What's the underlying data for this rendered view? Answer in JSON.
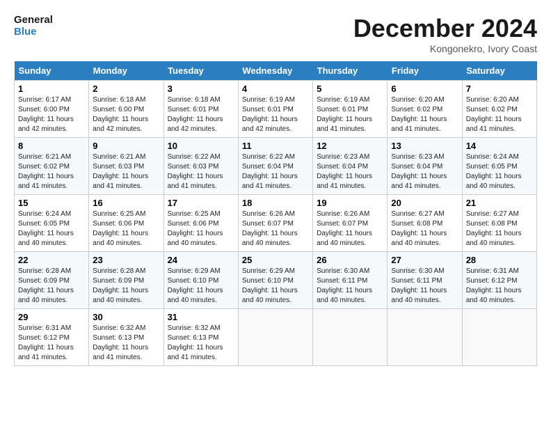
{
  "logo": {
    "line1": "General",
    "line2": "Blue"
  },
  "title": "December 2024",
  "location": "Kongonekro, Ivory Coast",
  "columns": [
    "Sunday",
    "Monday",
    "Tuesday",
    "Wednesday",
    "Thursday",
    "Friday",
    "Saturday"
  ],
  "weeks": [
    [
      {
        "day": "1",
        "rise": "6:17 AM",
        "set": "6:00 PM",
        "hours": "11 hours and 42 minutes."
      },
      {
        "day": "2",
        "rise": "6:18 AM",
        "set": "6:00 PM",
        "hours": "11 hours and 42 minutes."
      },
      {
        "day": "3",
        "rise": "6:18 AM",
        "set": "6:01 PM",
        "hours": "11 hours and 42 minutes."
      },
      {
        "day": "4",
        "rise": "6:19 AM",
        "set": "6:01 PM",
        "hours": "11 hours and 42 minutes."
      },
      {
        "day": "5",
        "rise": "6:19 AM",
        "set": "6:01 PM",
        "hours": "11 hours and 41 minutes."
      },
      {
        "day": "6",
        "rise": "6:20 AM",
        "set": "6:02 PM",
        "hours": "11 hours and 41 minutes."
      },
      {
        "day": "7",
        "rise": "6:20 AM",
        "set": "6:02 PM",
        "hours": "11 hours and 41 minutes."
      }
    ],
    [
      {
        "day": "8",
        "rise": "6:21 AM",
        "set": "6:02 PM",
        "hours": "11 hours and 41 minutes."
      },
      {
        "day": "9",
        "rise": "6:21 AM",
        "set": "6:03 PM",
        "hours": "11 hours and 41 minutes."
      },
      {
        "day": "10",
        "rise": "6:22 AM",
        "set": "6:03 PM",
        "hours": "11 hours and 41 minutes."
      },
      {
        "day": "11",
        "rise": "6:22 AM",
        "set": "6:04 PM",
        "hours": "11 hours and 41 minutes."
      },
      {
        "day": "12",
        "rise": "6:23 AM",
        "set": "6:04 PM",
        "hours": "11 hours and 41 minutes."
      },
      {
        "day": "13",
        "rise": "6:23 AM",
        "set": "6:04 PM",
        "hours": "11 hours and 41 minutes."
      },
      {
        "day": "14",
        "rise": "6:24 AM",
        "set": "6:05 PM",
        "hours": "11 hours and 40 minutes."
      }
    ],
    [
      {
        "day": "15",
        "rise": "6:24 AM",
        "set": "6:05 PM",
        "hours": "11 hours and 40 minutes."
      },
      {
        "day": "16",
        "rise": "6:25 AM",
        "set": "6:06 PM",
        "hours": "11 hours and 40 minutes."
      },
      {
        "day": "17",
        "rise": "6:25 AM",
        "set": "6:06 PM",
        "hours": "11 hours and 40 minutes."
      },
      {
        "day": "18",
        "rise": "6:26 AM",
        "set": "6:07 PM",
        "hours": "11 hours and 40 minutes."
      },
      {
        "day": "19",
        "rise": "6:26 AM",
        "set": "6:07 PM",
        "hours": "11 hours and 40 minutes."
      },
      {
        "day": "20",
        "rise": "6:27 AM",
        "set": "6:08 PM",
        "hours": "11 hours and 40 minutes."
      },
      {
        "day": "21",
        "rise": "6:27 AM",
        "set": "6:08 PM",
        "hours": "11 hours and 40 minutes."
      }
    ],
    [
      {
        "day": "22",
        "rise": "6:28 AM",
        "set": "6:09 PM",
        "hours": "11 hours and 40 minutes."
      },
      {
        "day": "23",
        "rise": "6:28 AM",
        "set": "6:09 PM",
        "hours": "11 hours and 40 minutes."
      },
      {
        "day": "24",
        "rise": "6:29 AM",
        "set": "6:10 PM",
        "hours": "11 hours and 40 minutes."
      },
      {
        "day": "25",
        "rise": "6:29 AM",
        "set": "6:10 PM",
        "hours": "11 hours and 40 minutes."
      },
      {
        "day": "26",
        "rise": "6:30 AM",
        "set": "6:11 PM",
        "hours": "11 hours and 40 minutes."
      },
      {
        "day": "27",
        "rise": "6:30 AM",
        "set": "6:11 PM",
        "hours": "11 hours and 40 minutes."
      },
      {
        "day": "28",
        "rise": "6:31 AM",
        "set": "6:12 PM",
        "hours": "11 hours and 40 minutes."
      }
    ],
    [
      {
        "day": "29",
        "rise": "6:31 AM",
        "set": "6:12 PM",
        "hours": "11 hours and 41 minutes."
      },
      {
        "day": "30",
        "rise": "6:32 AM",
        "set": "6:13 PM",
        "hours": "11 hours and 41 minutes."
      },
      {
        "day": "31",
        "rise": "6:32 AM",
        "set": "6:13 PM",
        "hours": "11 hours and 41 minutes."
      },
      null,
      null,
      null,
      null
    ]
  ],
  "labels": {
    "sunrise": "Sunrise:",
    "sunset": "Sunset:",
    "daylight": "Daylight:"
  }
}
